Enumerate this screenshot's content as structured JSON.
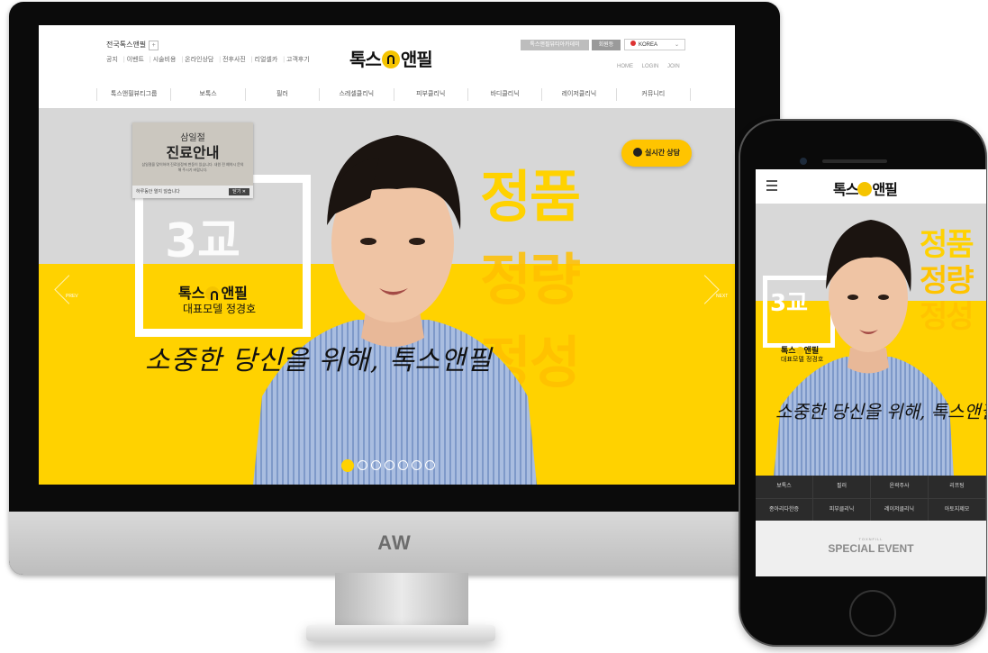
{
  "monitor": {
    "brand": "AW",
    "site": {
      "header": {
        "franchise_label": "전국톡스앤필",
        "franchise_plus": "+",
        "top_links": [
          "공지",
          "이벤트",
          "시술비용",
          "온라인상담",
          "전후사진",
          "리얼셀카",
          "고객후기"
        ],
        "logo_left": "톡스",
        "logo_right": "앤필",
        "btn_academy": "톡스앤필뷰티아카데미",
        "btn_recruit": "회원등",
        "lang": "KOREA",
        "util_links": [
          "HOME",
          "LOGIN",
          "JOIN"
        ]
      },
      "gnb": [
        "톡스앤필뷰티그룹",
        "보톡스",
        "필러",
        "스레셀클리닉",
        "피부클리닉",
        "바디클리닉",
        "레이저클리닉",
        "커뮤니티"
      ],
      "hero": {
        "words": [
          "정품",
          "정량",
          "정성"
        ],
        "badge_3": "3교",
        "model_logo_left": "톡스",
        "model_logo_right": "앤필",
        "model_name": "대표모델 정경호",
        "script": "소중한 당신을 위해, 톡스앤필",
        "consult_label": "실시간 상담",
        "popup": {
          "line1": "삼일절",
          "line2": "진료안내",
          "body": "삼일절을 맞이하여 진료일정에 변동이 있습니다. 내원 전 예약시 문의해 주시기 바랍니다.",
          "foot": "하루동안 열지 않습니다",
          "close": "닫기 ✕"
        },
        "prev_label": "PREV",
        "next_label": "NEXT",
        "dots_total": 7,
        "active_dot": 1
      }
    }
  },
  "phone": {
    "logo_left": "톡스",
    "logo_right": "앤필",
    "words": [
      "정품",
      "정량",
      "정성"
    ],
    "badge_3": "3교",
    "model_logo_left": "톡스",
    "model_logo_right": "앤필",
    "model_name": "대표모델 정경호",
    "script": "소중한 당신을 위해, 톡스앤필",
    "nav": [
      "보톡스",
      "필러",
      "윤곽주사",
      "리프팅",
      "종아리다한증",
      "피부클리닉",
      "레이저클리닉",
      "아토지제모"
    ],
    "event_small": "TOXNFILL",
    "event_title": "SPECIAL EVENT"
  },
  "colors": {
    "brand_yellow": "#ffd200",
    "dark": "#111111",
    "hero_gray": "#d7d7d7"
  }
}
